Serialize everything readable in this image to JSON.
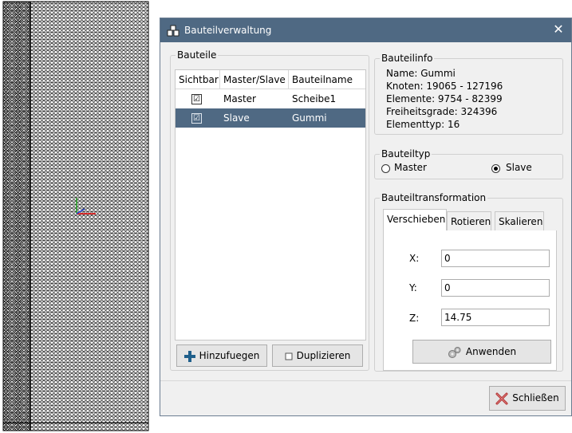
{
  "window": {
    "title": "Bauteilverwaltung",
    "close_icon": "close-icon"
  },
  "parts_group": {
    "label": "Bauteile",
    "columns": [
      "Sichtbar",
      "Master/Slave",
      "Bauteilname"
    ],
    "rows": [
      {
        "visible": "☑",
        "role": "Master",
        "name": "Scheibe1",
        "selected": false
      },
      {
        "visible": "☑",
        "role": "Slave",
        "name": "Gummi",
        "selected": true
      }
    ],
    "add_label": "Hinzufuegen",
    "duplicate_label": "Duplizieren"
  },
  "info_group": {
    "label": "Bauteilinfo",
    "lines": [
      "Name: Gummi",
      "Knoten: 19065 - 127196",
      "Elemente: 9754 - 82399",
      "Freiheitsgrade: 324396",
      "Elementtyp: 16"
    ]
  },
  "type_group": {
    "label": "Bauteiltyp",
    "master_label": "Master",
    "slave_label": "Slave",
    "selected": "Slave"
  },
  "transform_group": {
    "label": "Bauteiltransformation",
    "tabs": [
      "Verschieben",
      "Rotieren",
      "Skalieren"
    ],
    "active_tab": "Verschieben",
    "x_label": "X:",
    "x_value": "0",
    "y_label": "Y:",
    "y_value": "0",
    "z_label": "Z:",
    "z_value": "14.75",
    "apply_label": "Anwenden"
  },
  "close_button": {
    "label": "Schließen"
  },
  "colors": {
    "titlebar": "#4f6983",
    "selection": "#4f6983",
    "add_icon": "#1f5f8b",
    "close_icon_red": "#b03030"
  }
}
